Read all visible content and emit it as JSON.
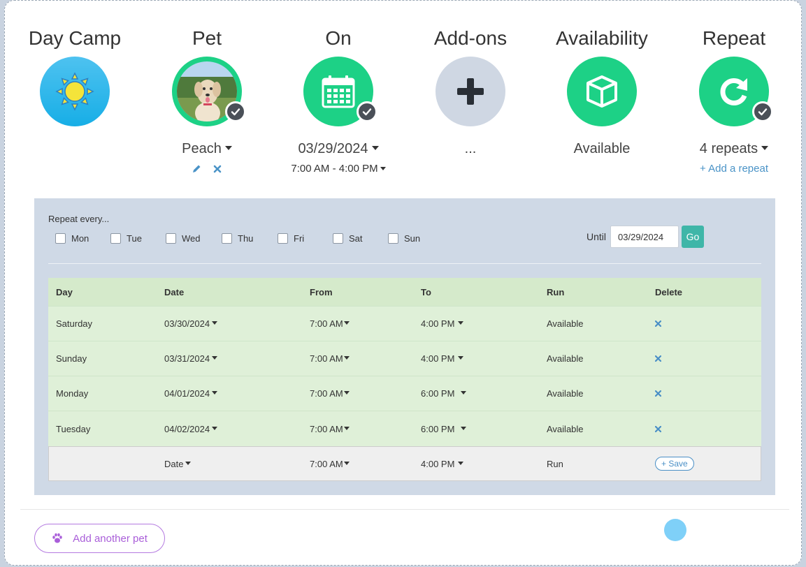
{
  "steps": {
    "service": {
      "title": "Day Camp",
      "icon": "sun-icon",
      "color": "#1fb1ea"
    },
    "pet": {
      "title": "Pet",
      "value": "Peach",
      "icon": "pet-photo",
      "actions": [
        "edit-icon",
        "remove-icon"
      ]
    },
    "on": {
      "title": "On",
      "date": "03/29/2024",
      "time": "7:00 AM - 4:00 PM",
      "icon": "calendar-icon",
      "color": "#1dd186"
    },
    "addons": {
      "title": "Add-ons",
      "value": "...",
      "icon": "plus-icon",
      "color": "#cfd7e3"
    },
    "availability": {
      "title": "Availability",
      "value": "Available",
      "icon": "box-icon",
      "color": "#1dd186"
    },
    "repeat": {
      "title": "Repeat",
      "value": "4 repeats",
      "link": "+ Add a repeat",
      "icon": "repeat-icon",
      "color": "#1dd186"
    }
  },
  "repeat_panel": {
    "label": "Repeat every...",
    "days": [
      "Mon",
      "Tue",
      "Wed",
      "Thu",
      "Fri",
      "Sat",
      "Sun"
    ],
    "until_label": "Until",
    "until_value": "03/29/2024",
    "go_label": "Go"
  },
  "table": {
    "headers": [
      "Day",
      "Date",
      "From",
      "To",
      "Run",
      "Delete"
    ],
    "rows": [
      {
        "day": "Saturday",
        "date": "03/30/2024",
        "from": "7:00 AM",
        "to": "4:00 PM",
        "run": "Available"
      },
      {
        "day": "Sunday",
        "date": "03/31/2024",
        "from": "7:00 AM",
        "to": "4:00 PM",
        "run": "Available"
      },
      {
        "day": "Monday",
        "date": "04/01/2024",
        "from": "7:00 AM",
        "to": "6:00 PM",
        "run": "Available"
      },
      {
        "day": "Tuesday",
        "date": "04/02/2024",
        "from": "7:00 AM",
        "to": "6:00 PM",
        "run": "Available"
      }
    ],
    "new_row": {
      "date": "Date",
      "from": "7:00 AM",
      "to": "4:00 PM",
      "run": "Run",
      "save": "+ Save"
    }
  },
  "footer": {
    "add_pet_label": "Add another pet"
  },
  "colors": {
    "accent_green": "#1dd186",
    "teal": "#3fb6a8",
    "purple": "#a95ed9",
    "link_blue": "#4a93c7"
  }
}
